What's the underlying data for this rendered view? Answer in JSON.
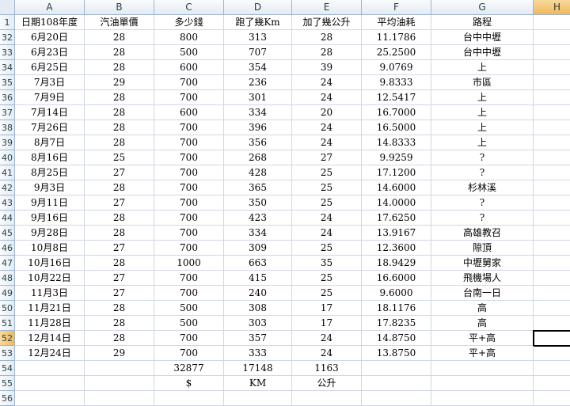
{
  "columns": [
    "A",
    "B",
    "C",
    "D",
    "E",
    "F",
    "G",
    "H"
  ],
  "selected_column": "H",
  "selected_row": "52",
  "header_row": {
    "num": "1",
    "cells": [
      "日期108年度",
      "汽油單價",
      "多少錢",
      "跑了幾Km",
      "加了幾公升",
      "平均油耗",
      "路程"
    ]
  },
  "rows": [
    {
      "num": "32",
      "cells": [
        "6月20日",
        "28",
        "800",
        "313",
        "28",
        "11.1786",
        "台中中壢"
      ]
    },
    {
      "num": "33",
      "cells": [
        "6月23日",
        "28",
        "500",
        "707",
        "28",
        "25.2500",
        "台中中壢"
      ]
    },
    {
      "num": "34",
      "cells": [
        "6月25日",
        "28",
        "600",
        "354",
        "39",
        "9.0769",
        "上"
      ]
    },
    {
      "num": "35",
      "cells": [
        "7月3日",
        "29",
        "700",
        "236",
        "24",
        "9.8333",
        "市區"
      ]
    },
    {
      "num": "36",
      "cells": [
        "7月9日",
        "28",
        "700",
        "301",
        "24",
        "12.5417",
        "上"
      ]
    },
    {
      "num": "37",
      "cells": [
        "7月14日",
        "28",
        "600",
        "334",
        "20",
        "16.7000",
        "上"
      ]
    },
    {
      "num": "38",
      "cells": [
        "7月26日",
        "28",
        "700",
        "396",
        "24",
        "16.5000",
        "上"
      ]
    },
    {
      "num": "39",
      "cells": [
        "8月7日",
        "28",
        "700",
        "356",
        "24",
        "14.8333",
        "上"
      ]
    },
    {
      "num": "40",
      "cells": [
        "8月16日",
        "25",
        "700",
        "268",
        "27",
        "9.9259",
        "?"
      ]
    },
    {
      "num": "41",
      "cells": [
        "8月25日",
        "27",
        "700",
        "428",
        "25",
        "17.1200",
        "?"
      ]
    },
    {
      "num": "42",
      "cells": [
        "9月3日",
        "28",
        "700",
        "365",
        "25",
        "14.6000",
        "杉林溪"
      ]
    },
    {
      "num": "43",
      "cells": [
        "9月11日",
        "27",
        "700",
        "350",
        "25",
        "14.0000",
        "?"
      ]
    },
    {
      "num": "44",
      "cells": [
        "9月16日",
        "28",
        "700",
        "423",
        "24",
        "17.6250",
        "?"
      ]
    },
    {
      "num": "45",
      "cells": [
        "9月28日",
        "28",
        "700",
        "334",
        "24",
        "13.9167",
        "高雄教召"
      ]
    },
    {
      "num": "46",
      "cells": [
        "10月8日",
        "27",
        "700",
        "309",
        "25",
        "12.3600",
        "隙頂"
      ]
    },
    {
      "num": "47",
      "cells": [
        "10月16日",
        "28",
        "1000",
        "663",
        "35",
        "18.9429",
        "中壢舅家"
      ]
    },
    {
      "num": "48",
      "cells": [
        "10月22日",
        "27",
        "700",
        "415",
        "25",
        "16.6000",
        "飛機場人"
      ]
    },
    {
      "num": "49",
      "cells": [
        "11月3日",
        "27",
        "700",
        "240",
        "25",
        "9.6000",
        "台南一日"
      ]
    },
    {
      "num": "50",
      "cells": [
        "11月21日",
        "28",
        "500",
        "308",
        "17",
        "18.1176",
        "高"
      ]
    },
    {
      "num": "51",
      "cells": [
        "11月28日",
        "28",
        "500",
        "303",
        "17",
        "17.8235",
        "高"
      ]
    },
    {
      "num": "52",
      "cells": [
        "12月14日",
        "28",
        "700",
        "357",
        "24",
        "14.8750",
        "平+高"
      ]
    },
    {
      "num": "53",
      "cells": [
        "12月24日",
        "29",
        "700",
        "333",
        "24",
        "13.8750",
        "平+高"
      ]
    },
    {
      "num": "54",
      "cells": [
        "",
        "",
        "32877",
        "17148",
        "1163",
        "",
        ""
      ]
    },
    {
      "num": "55",
      "cells": [
        "",
        "",
        "$",
        "KM",
        "公升",
        "",
        ""
      ]
    },
    {
      "num": "56",
      "cells": [
        "",
        "",
        "",
        "",
        "",
        "",
        ""
      ]
    }
  ]
}
